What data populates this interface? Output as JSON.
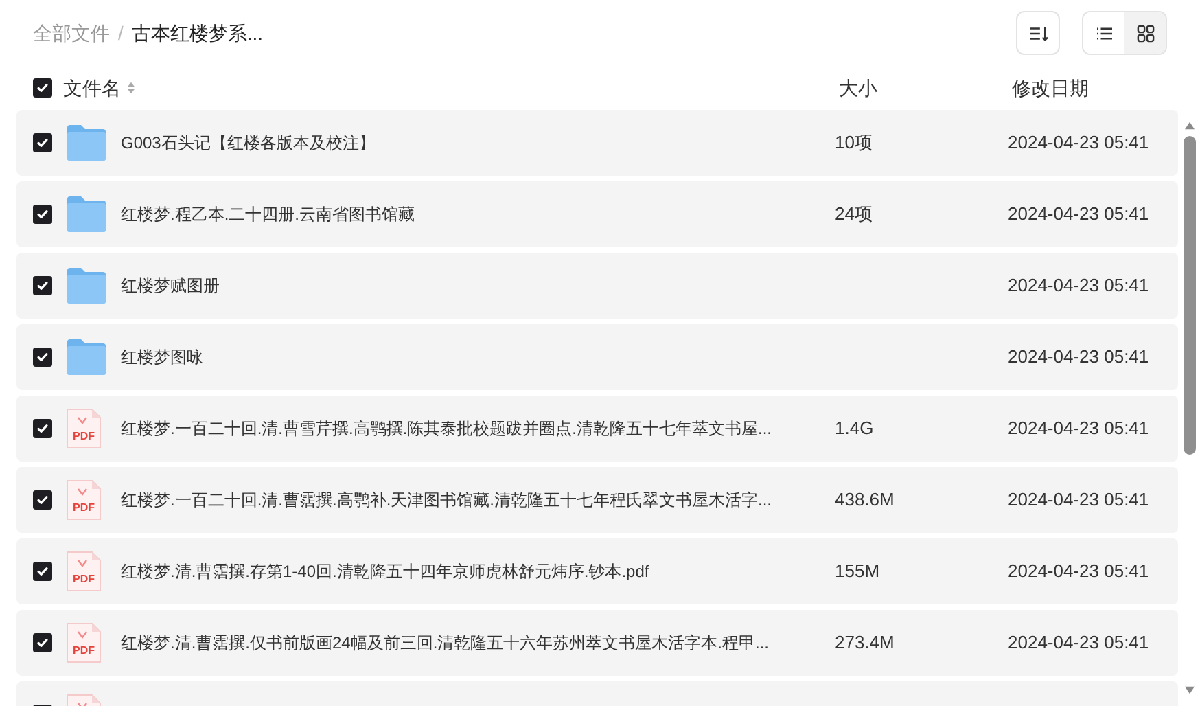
{
  "breadcrumb": [
    {
      "label": "全部文件",
      "current": false
    },
    {
      "label": "古本红楼梦系...",
      "current": true
    }
  ],
  "breadcrumb_separator": "/",
  "toolbar": {
    "sort_icon": true,
    "views": [
      {
        "kind": "list",
        "selected": true
      },
      {
        "kind": "grid",
        "selected": false
      }
    ]
  },
  "header": {
    "all_checked": true,
    "columns": [
      "文件名",
      "大小",
      "修改日期"
    ]
  },
  "rows": [
    {
      "kind": "folder",
      "checked": true,
      "name": "G003石头记【红楼各版本及校注】",
      "size": "10项",
      "date": "2024-04-23 05:41"
    },
    {
      "kind": "folder",
      "checked": true,
      "name": "红楼梦.程乙本.二十四册.云南省图书馆藏",
      "size": "24项",
      "date": "2024-04-23 05:41"
    },
    {
      "kind": "folder",
      "checked": true,
      "name": "红楼梦赋图册",
      "date": "2024-04-23 05:41"
    },
    {
      "kind": "folder",
      "checked": true,
      "name": "红楼梦图咏",
      "date": "2024-04-23 05:41"
    },
    {
      "kind": "pdf",
      "badge": "PDF",
      "checked": true,
      "name": "红楼梦.一百二十回.清.曹雪芹撰.高鹗撰.陈其泰批校题跋并圈点.清乾隆五十七年萃文书屋...",
      "size": "1.4G",
      "date": "2024-04-23 05:41"
    },
    {
      "kind": "pdf",
      "badge": "PDF",
      "checked": true,
      "name": "红楼梦.一百二十回.清.曹霑撰.高鹗补.天津图书馆藏.清乾隆五十七年程氏翠文书屋木活字...",
      "size": "438.6M",
      "date": "2024-04-23 05:41"
    },
    {
      "kind": "pdf",
      "badge": "PDF",
      "checked": true,
      "name": "红楼梦.清.曹霑撰.存第1-40回.清乾隆五十四年京师虎林舒元炜序.钞本.pdf",
      "size": "155M",
      "date": "2024-04-23 05:41"
    },
    {
      "kind": "pdf",
      "badge": "PDF",
      "checked": true,
      "name": "红楼梦.清.曹霑撰.仅书前版画24幅及前三回.清乾隆五十六年苏州萃文书屋木活字本.程甲...",
      "size": "273.4M",
      "date": "2024-04-23 05:41"
    },
    {
      "kind": "pdf",
      "checked": true
    }
  ]
}
